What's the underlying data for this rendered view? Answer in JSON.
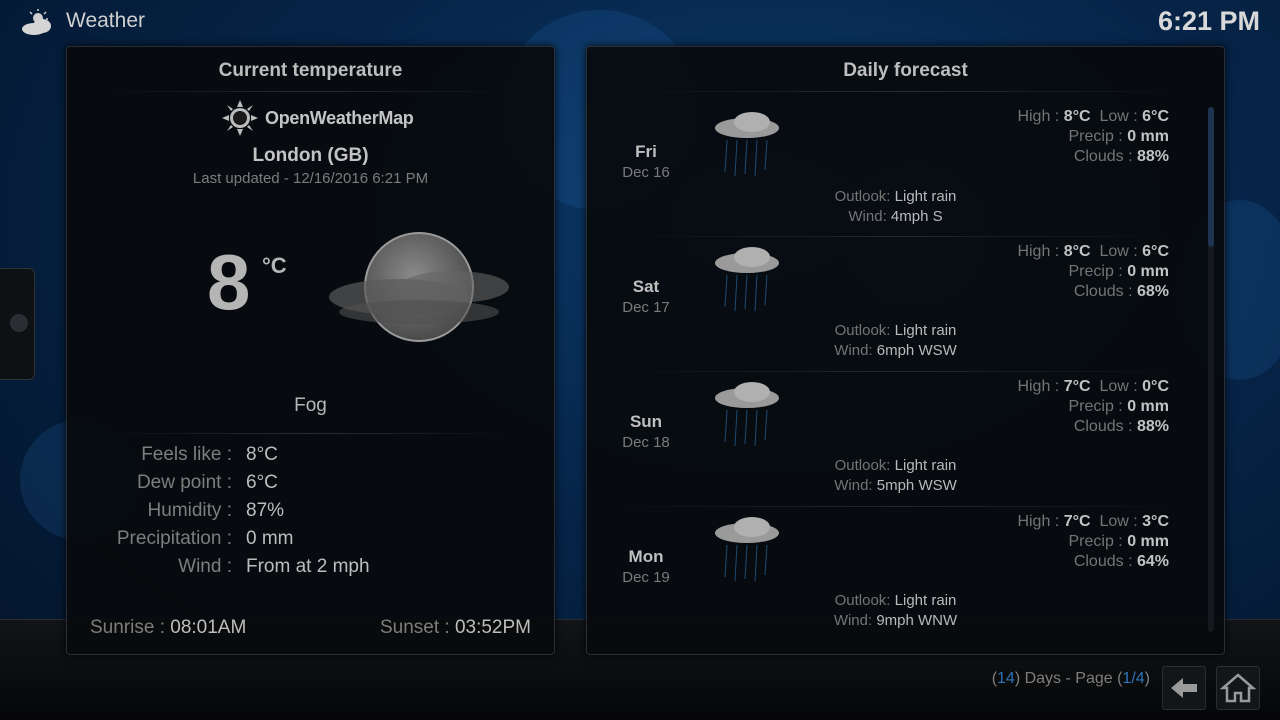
{
  "app": {
    "title": "Weather",
    "clock": "6:21 PM"
  },
  "current": {
    "panel_title": "Current temperature",
    "provider": "OpenWeatherMap",
    "city": "London (GB)",
    "last_updated": "Last updated - 12/16/2016 6:21 PM",
    "temperature": "8",
    "unit": "°C",
    "condition": "Fog",
    "details": [
      {
        "label": "Feels like :",
        "value": "8°C"
      },
      {
        "label": "Dew point :",
        "value": "6°C"
      },
      {
        "label": "Humidity :",
        "value": "87%"
      },
      {
        "label": "Precipitation :",
        "value": "0 mm"
      },
      {
        "label": "Wind :",
        "value": "From  at 2 mph"
      }
    ],
    "sunrise_label": "Sunrise :",
    "sunrise": "08:01AM",
    "sunset_label": "Sunset :",
    "sunset": "03:52PM"
  },
  "forecast": {
    "panel_title": "Daily forecast",
    "labels": {
      "high": "High :",
      "low": "Low :",
      "precip": "Precip :",
      "clouds": "Clouds :",
      "outlook": "Outlook:",
      "wind": "Wind:"
    },
    "days": [
      {
        "day": "Fri",
        "date": "Dec 16",
        "high": "8°C",
        "low": "6°C",
        "precip": "0 mm",
        "clouds": "88%",
        "outlook": "Light rain",
        "wind": "4mph S"
      },
      {
        "day": "Sat",
        "date": "Dec 17",
        "high": "8°C",
        "low": "6°C",
        "precip": "0 mm",
        "clouds": "68%",
        "outlook": "Light rain",
        "wind": "6mph WSW"
      },
      {
        "day": "Sun",
        "date": "Dec 18",
        "high": "7°C",
        "low": "0°C",
        "precip": "0 mm",
        "clouds": "88%",
        "outlook": "Light rain",
        "wind": "5mph WSW"
      },
      {
        "day": "Mon",
        "date": "Dec 19",
        "high": "7°C",
        "low": "3°C",
        "precip": "0 mm",
        "clouds": "64%",
        "outlook": "Light rain",
        "wind": "9mph WNW"
      }
    ]
  },
  "footer": {
    "days_count": "14",
    "days_text": ") Days - Page (",
    "page": "1/4",
    "open_paren": "(",
    "close_paren": ")"
  }
}
